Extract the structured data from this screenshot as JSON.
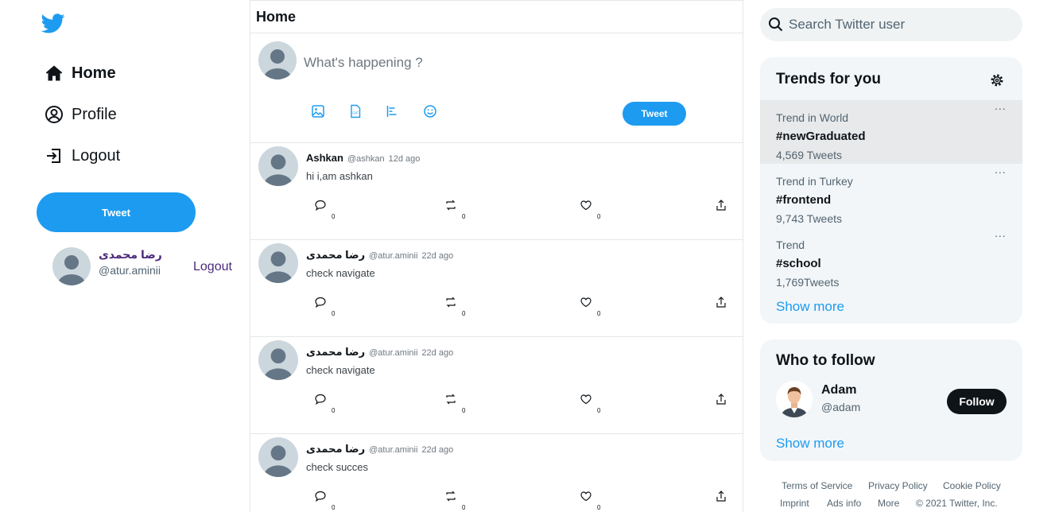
{
  "nav": {
    "items": [
      {
        "label": "Home",
        "icon": "home-icon"
      },
      {
        "label": "Profile",
        "icon": "user-circle-icon"
      },
      {
        "label": "Logout",
        "icon": "logout-icon"
      }
    ],
    "tweet_button": "Tweet"
  },
  "current_user": {
    "name": "رضا محمدی",
    "handle": "@atur.aminii",
    "logout": "Logout"
  },
  "feed": {
    "title": "Home",
    "compose": {
      "placeholder": "What's happening ?",
      "tools": [
        "image-icon",
        "gif-icon",
        "poll-icon",
        "emoji-icon"
      ],
      "tweet_button": "Tweet"
    },
    "posts": [
      {
        "name": "Ashkan",
        "handle": "@ashkan",
        "time": "12d ago",
        "text": "hi i,am ashkan",
        "replies": "0",
        "retweets": "0",
        "likes": "0"
      },
      {
        "name": "رضا محمدی",
        "handle": "@atur.aminii",
        "time": "22d ago",
        "text": "check navigate",
        "replies": "0",
        "retweets": "0",
        "likes": "0"
      },
      {
        "name": "رضا محمدی",
        "handle": "@atur.aminii",
        "time": "22d ago",
        "text": "check navigate",
        "replies": "0",
        "retweets": "0",
        "likes": "0"
      },
      {
        "name": "رضا محمدی",
        "handle": "@atur.aminii",
        "time": "22d ago",
        "text": "check succes",
        "replies": "0",
        "retweets": "0",
        "likes": "0"
      }
    ]
  },
  "search": {
    "placeholder": "Search Twitter user"
  },
  "trends": {
    "title": "Trends for you",
    "items": [
      {
        "context": "Trend in World",
        "tag": "#newGraduated",
        "count": "4,569 Tweets"
      },
      {
        "context": "Trend in Turkey",
        "tag": "#frontend",
        "count": "9,743 Tweets"
      },
      {
        "context": "Trend",
        "tag": "#school",
        "count": "1,769Tweets"
      }
    ],
    "more_icon": "...",
    "show_more": "Show more"
  },
  "who_to_follow": {
    "title": "Who to follow",
    "user": {
      "name": "Adam",
      "handle": "@adam"
    },
    "follow_button": "Follow",
    "show_more": "Show more"
  },
  "footer": {
    "row1": [
      "Terms of Service",
      "Privacy Policy",
      "Cookie Policy"
    ],
    "row2": [
      "Imprint",
      "Ads info",
      "More",
      "© 2021 Twitter, Inc."
    ]
  },
  "colors": {
    "accent": "#1d9bf0",
    "username_purple": "#4b2a7a",
    "card_bg": "#f2f6f8",
    "dark_button": "#0f1419"
  }
}
